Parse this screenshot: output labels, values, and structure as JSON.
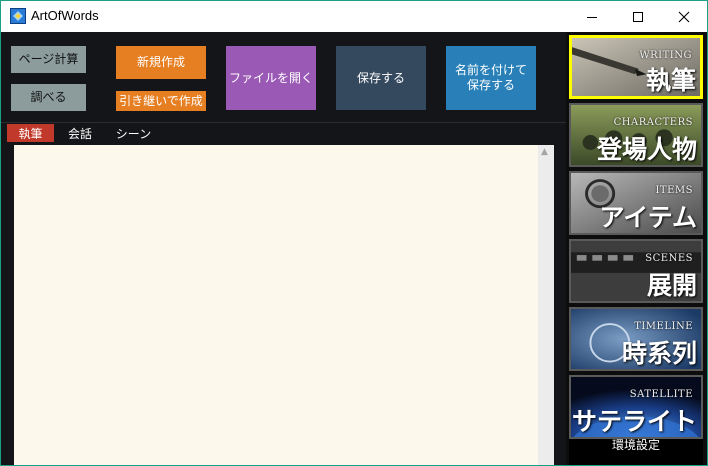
{
  "window": {
    "title": "ArtOfWords"
  },
  "toolbar": {
    "page_calc": "ページ計算",
    "lookup": "調べる",
    "new_create": "新規作成",
    "inherit_create": "引き継いで作成",
    "open_file": "ファイルを開く",
    "save": "保存する",
    "save_as_line1": "名前を付けて",
    "save_as_line2": "保存する"
  },
  "tabs": [
    {
      "label": "執筆",
      "active": true
    },
    {
      "label": "会話",
      "active": false
    },
    {
      "label": "シーン",
      "active": false
    }
  ],
  "editor": {
    "content": ""
  },
  "side_tiles": [
    {
      "en": "WRITING",
      "jp": "執筆",
      "active": true,
      "icon": "pen-icon"
    },
    {
      "en": "CHARACTERS",
      "jp": "登場人物",
      "active": false,
      "icon": "people-icon"
    },
    {
      "en": "ITEMS",
      "jp": "アイテム",
      "active": false,
      "icon": "watch-icon"
    },
    {
      "en": "SCENES",
      "jp": "展開",
      "active": false,
      "icon": "film-icon"
    },
    {
      "en": "TIMELINE",
      "jp": "時系列",
      "active": false,
      "icon": "clock-icon"
    },
    {
      "en": "SATELLITE",
      "jp": "サテライト",
      "active": false,
      "icon": "earth-icon"
    }
  ],
  "settings_label": "環境設定",
  "colors": {
    "orange": "#e67e22",
    "purple": "#9b59b6",
    "slate": "#34495e",
    "blue": "#2980b9",
    "active_tab": "#c0392b",
    "active_tile_border": "#ffff00"
  }
}
